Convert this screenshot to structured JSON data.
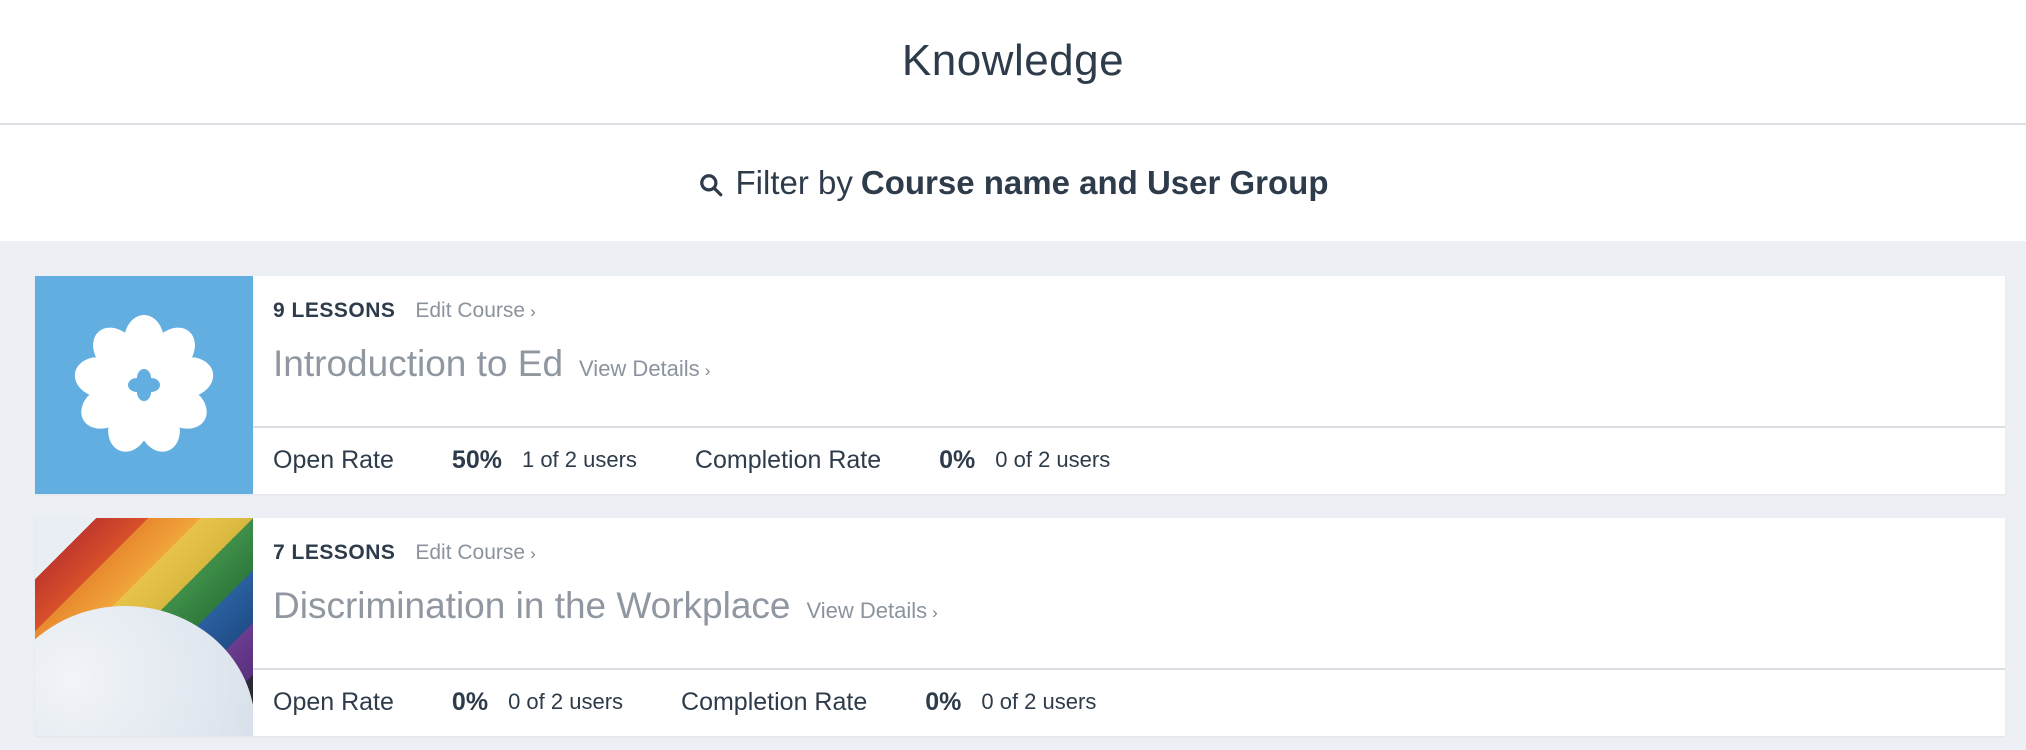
{
  "header": {
    "title": "Knowledge"
  },
  "filter": {
    "prefix": "Filter by",
    "strong": "Course name and User Group",
    "icon": "search-icon"
  },
  "courses": [
    {
      "lessons": "9 LESSONS",
      "edit_label": "Edit Course",
      "title": "Introduction to Ed",
      "view_label": "View Details",
      "thumb": "flower-logo",
      "open_rate_label": "Open Rate",
      "open_rate_pct": "50%",
      "open_rate_users": "1 of 2 users",
      "completion_label": "Completion Rate",
      "completion_pct": "0%",
      "completion_users": "0 of 2 users"
    },
    {
      "lessons": "7 LESSONS",
      "edit_label": "Edit Course",
      "title": "Discrimination in the Workplace",
      "view_label": "View Details",
      "thumb": "rainbow-flag-photo",
      "open_rate_label": "Open Rate",
      "open_rate_pct": "0%",
      "open_rate_users": "0 of 2 users",
      "completion_label": "Completion Rate",
      "completion_pct": "0%",
      "completion_users": "0 of 2 users"
    }
  ],
  "colors": {
    "accent_blue": "#62aee0",
    "background": "#eceff3",
    "text": "#2e3b4a",
    "muted": "#8a939e"
  }
}
